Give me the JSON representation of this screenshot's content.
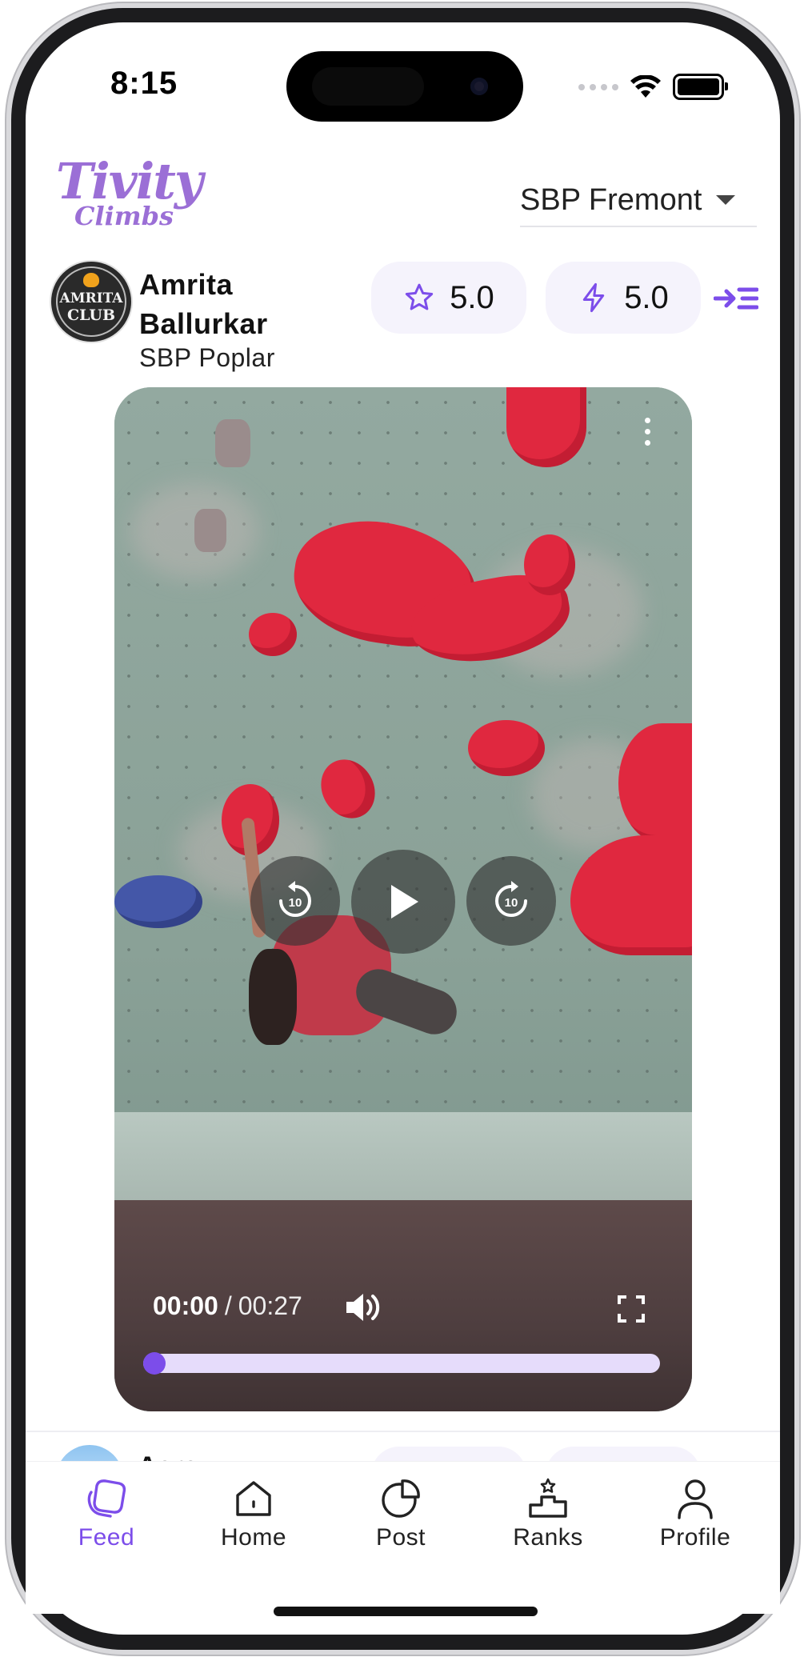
{
  "status_bar": {
    "time": "8:15"
  },
  "header": {
    "logo_line1": "Tivity",
    "logo_line2": "Climbs",
    "gym_selector": "SBP Fremont"
  },
  "post": {
    "avatar_text_line1": "AMRITA",
    "avatar_text_line2": "CLUB",
    "user_name": "Amrita Ballurkar",
    "gym": "SBP Poplar",
    "rating_quality": "5.0",
    "rating_difficulty": "5.0",
    "video": {
      "current_time": "00:00",
      "separator": "/",
      "duration": "00:27",
      "progress_fraction": 0,
      "rewind_seconds": "10",
      "forward_seconds": "10"
    }
  },
  "next_post": {
    "user_name_partial": "Aarav"
  },
  "tabbar": {
    "tabs": [
      {
        "label": "Feed",
        "icon": "feed-icon",
        "active": true
      },
      {
        "label": "Home",
        "icon": "home-icon",
        "active": false
      },
      {
        "label": "Post",
        "icon": "post-icon",
        "active": false
      },
      {
        "label": "Ranks",
        "icon": "ranks-icon",
        "active": false
      },
      {
        "label": "Profile",
        "icon": "profile-icon",
        "active": false
      }
    ]
  },
  "colors": {
    "accent": "#7c4dea",
    "logo": "#9b6fd6",
    "pill_bg": "#f5f3fc",
    "progress_track": "#e6dcfb"
  }
}
